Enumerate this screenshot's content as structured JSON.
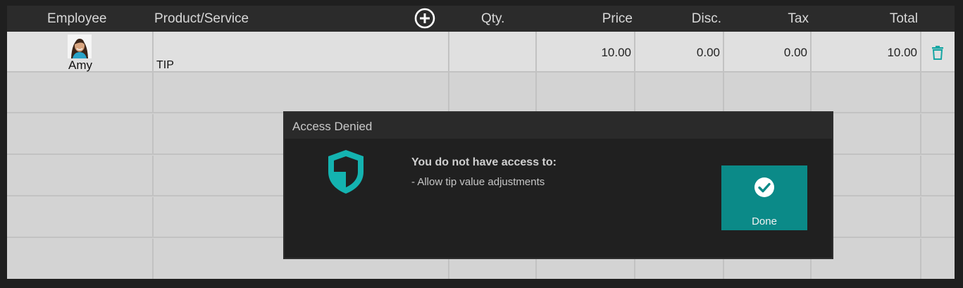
{
  "table": {
    "columns": {
      "employee": "Employee",
      "product": "Product/Service",
      "qty": "Qty.",
      "price": "Price",
      "disc": "Disc.",
      "tax": "Tax",
      "total": "Total"
    },
    "rows": [
      {
        "employee": "Amy",
        "product": "TIP",
        "qty": "",
        "price": "10.00",
        "disc": "0.00",
        "tax": "0.00",
        "total": "10.00"
      }
    ]
  },
  "icons": {
    "add": "plus-circle-icon",
    "delete": "trash-icon",
    "shield": "shield-icon",
    "done": "check-circle-icon"
  },
  "dialog": {
    "title": "Access Denied",
    "message_heading": "You do not have access to:",
    "message_items": [
      "- Allow tip value adjustments"
    ],
    "done_label": "Done"
  },
  "colors": {
    "accent": "#0b8a88",
    "shield": "#14b3b0"
  }
}
